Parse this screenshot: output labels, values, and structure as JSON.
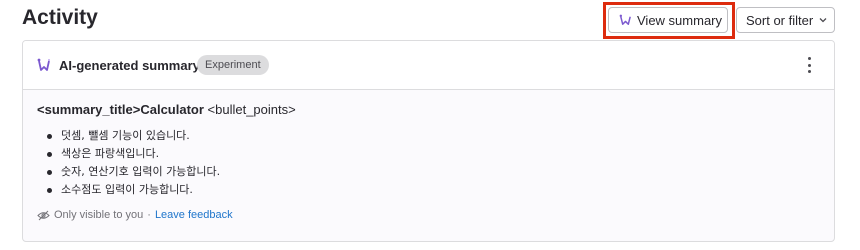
{
  "header": {
    "title": "Activity",
    "view_summary_label": "View summary",
    "sort_filter_label": "Sort or filter"
  },
  "card": {
    "title": "AI-generated summary",
    "badge": "Experiment",
    "summary_tag": "<summary_title>Calculator",
    "summary_tag_rest": " <bullet_points>",
    "bullets": [
      "덧셈, 뺄셈 기능이 있습니다.",
      "색상은 파랑색입니다.",
      "숫자, 연산기호 입력이 가능합니다.",
      "소수점도 입력이 가능합니다."
    ],
    "visibility_note": "Only visible to you",
    "separator": "·",
    "feedback_link": "Leave feedback"
  },
  "colors": {
    "highlight": "#dd2b0e",
    "link": "#1f75cb",
    "ai_icon": "#7b58cf"
  },
  "icons": [
    "ai-summary-icon",
    "chevron-down-icon",
    "tanuki-ai-icon",
    "kebab-menu-icon",
    "eye-slash-icon"
  ]
}
